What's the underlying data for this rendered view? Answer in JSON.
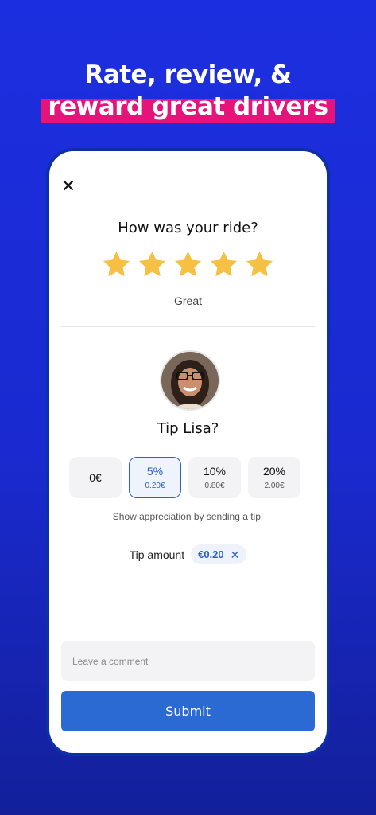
{
  "headline": {
    "line1": "Rate, review, &",
    "line2": "reward great drivers"
  },
  "colors": {
    "accent": "#2c6ad3",
    "highlight": "#e6137b",
    "star": "#f6c043",
    "background": "#1c2fe0"
  },
  "rating": {
    "close_icon": "close-icon",
    "question": "How was your ride?",
    "stars_filled": 5,
    "stars_total": 5,
    "label": "Great"
  },
  "driver": {
    "avatar_icon": "driver-avatar",
    "tip_question": "Tip Lisa?"
  },
  "tips": [
    {
      "percent": "0€",
      "amount": ""
    },
    {
      "percent": "5%",
      "amount": "0.20€",
      "selected": true
    },
    {
      "percent": "10%",
      "amount": "0.80€"
    },
    {
      "percent": "20%",
      "amount": "2.00€"
    }
  ],
  "tip_hint": "Show appreciation by sending a tip!",
  "tip_amount": {
    "label": "Tip amount",
    "value": "€0.20",
    "clear_icon": "close-icon"
  },
  "comment": {
    "placeholder": "Leave a comment",
    "value": ""
  },
  "submit_label": "Submit"
}
